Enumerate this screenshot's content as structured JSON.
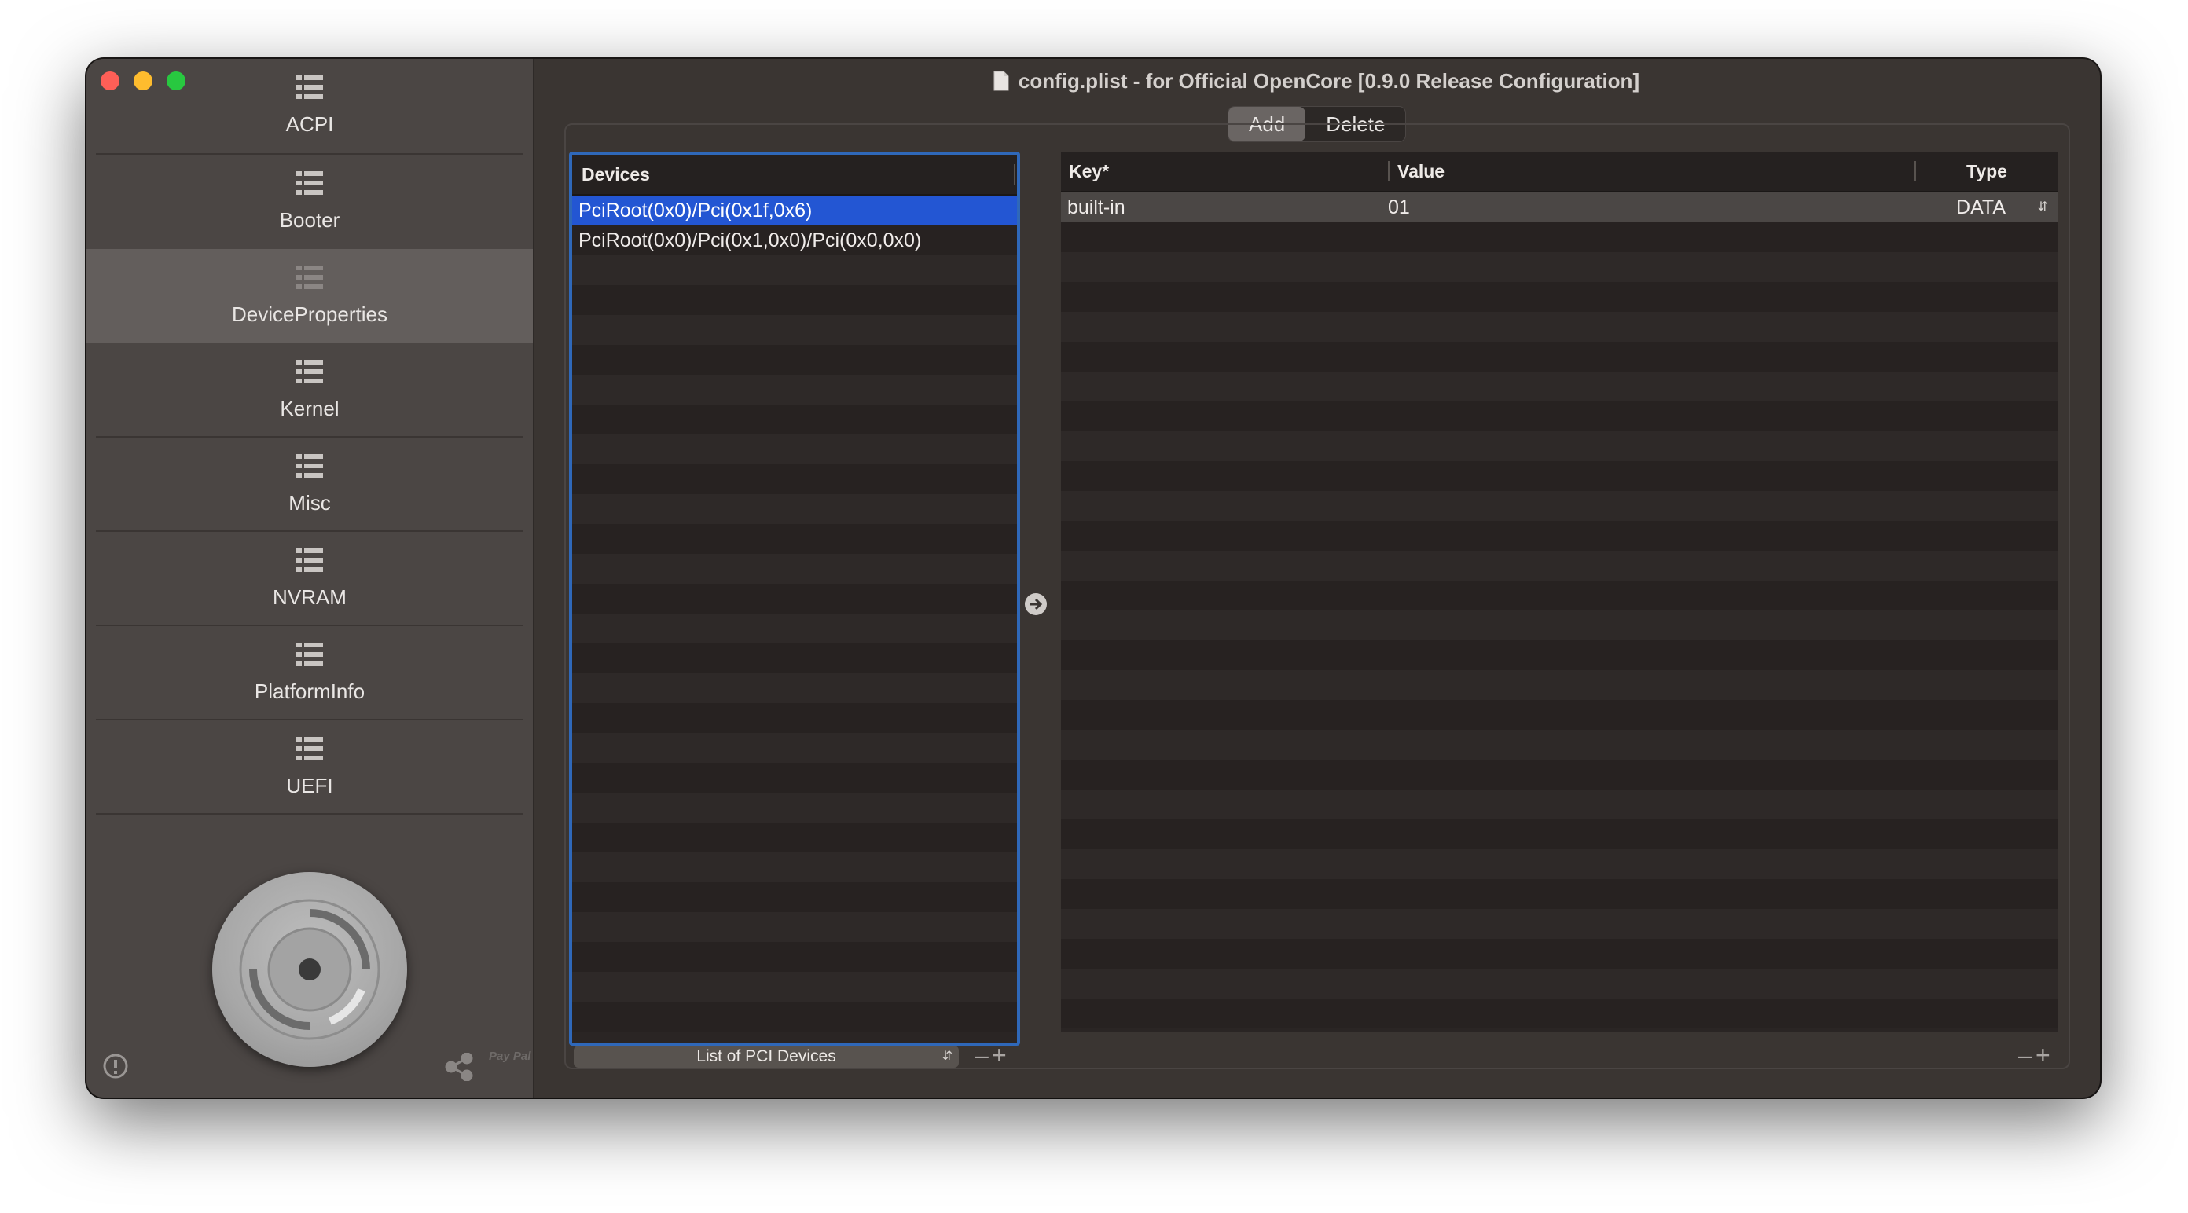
{
  "window": {
    "title": "config.plist - for Official OpenCore [0.9.0 Release Configuration]"
  },
  "sidebar": {
    "items": [
      {
        "label": "ACPI",
        "icon": "list-icon"
      },
      {
        "label": "Booter",
        "icon": "list-icon"
      },
      {
        "label": "DeviceProperties",
        "icon": "list-icon",
        "active": true
      },
      {
        "label": "Kernel",
        "icon": "list-icon"
      },
      {
        "label": "Misc",
        "icon": "list-icon"
      },
      {
        "label": "NVRAM",
        "icon": "list-icon"
      },
      {
        "label": "PlatformInfo",
        "icon": "list-icon"
      },
      {
        "label": "UEFI",
        "icon": "list-icon"
      }
    ],
    "paypal_text": "Pay Pal"
  },
  "segmented": {
    "add_label": "Add",
    "delete_label": "Delete",
    "selected": "Add"
  },
  "devices": {
    "header": "Devices",
    "rows": [
      "PciRoot(0x0)/Pci(0x1f,0x6)",
      "PciRoot(0x0)/Pci(0x1,0x0)/Pci(0x0,0x0)"
    ],
    "selected_index": 0,
    "footer_dropdown": "List of PCI Devices"
  },
  "properties": {
    "columns": {
      "key": "Key*",
      "value": "Value",
      "type": "Type"
    },
    "rows": [
      {
        "key": "built-in",
        "value": "01",
        "type": "DATA"
      }
    ]
  },
  "colors": {
    "selection": "#2356d3",
    "focus_ring": "#2f68b9",
    "traffic_red": "#fe5f57",
    "traffic_yellow": "#febc2e",
    "traffic_green": "#28c840"
  }
}
